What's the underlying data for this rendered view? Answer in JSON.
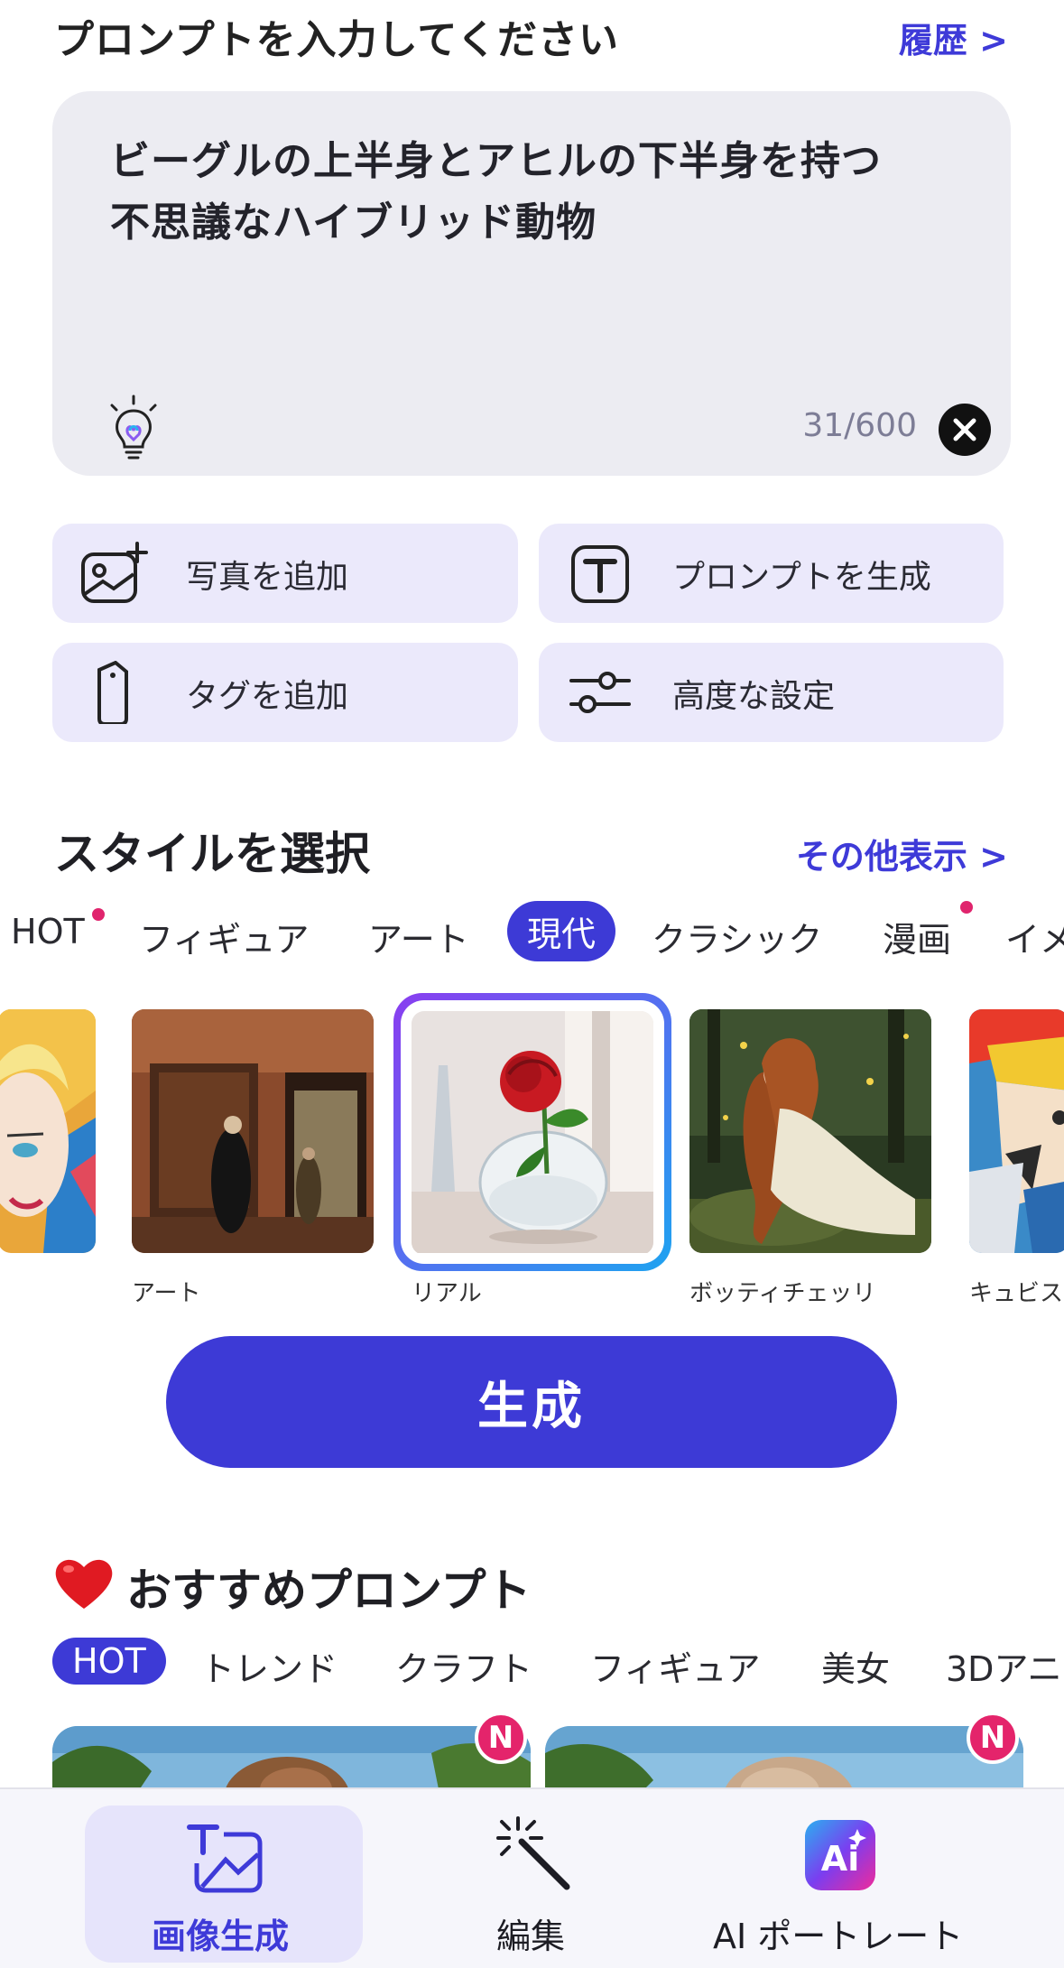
{
  "header": {
    "title": "プロンプトを入力してください",
    "history_link": "履歴 >"
  },
  "prompt": {
    "text_line1": "ビーグルの上半身とアヒルの下半身を持つ",
    "text_line2": "不思議なハイブリッド動物",
    "char_count": "31/600"
  },
  "actions": {
    "add_photo": "写真を追加",
    "generate_prompt": "プロンプトを生成",
    "add_tag": "タグを追加",
    "advanced_settings": "高度な設定"
  },
  "style_section": {
    "title": "スタイルを選択",
    "more_link": "その他表示 >",
    "tabs": [
      "HOT",
      "フィギュア",
      "アート",
      "現代",
      "クラシック",
      "漫画",
      "イメ"
    ],
    "active_tab": "現代",
    "thumbnails": [
      {
        "label": ""
      },
      {
        "label": "アート"
      },
      {
        "label": "リアル"
      },
      {
        "label": "ボッティチェッリ"
      },
      {
        "label": "キュビス"
      }
    ],
    "selected": "リアル"
  },
  "generate_button": "生成",
  "recommended": {
    "title": "おすすめプロンプト",
    "tabs": [
      "HOT",
      "トレンド",
      "クラフト",
      "フィギュア",
      "美女",
      "3Dアニ"
    ],
    "active_tab": "HOT",
    "badge": "N"
  },
  "bottom_nav": {
    "items": [
      "画像生成",
      "編集",
      "AI ポートレート"
    ],
    "active": "画像生成"
  },
  "colors": {
    "accent": "#3d3ad6",
    "badge": "#e4246b",
    "action_bg": "#ebe9fb",
    "prompt_bg": "#ececf2"
  }
}
